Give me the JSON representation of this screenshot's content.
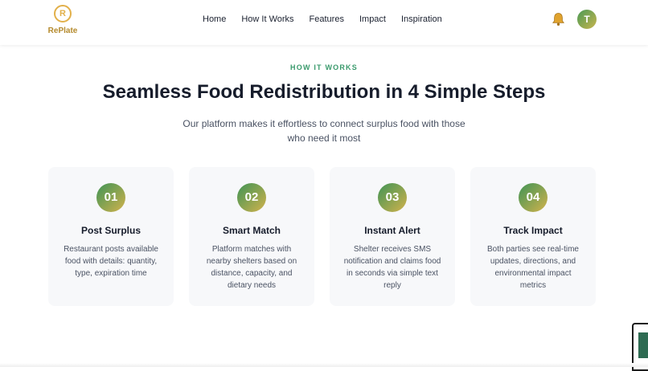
{
  "brand": {
    "name": "RePlate",
    "logo_letter": "R",
    "icon": "replate-logo-icon"
  },
  "nav": {
    "items": [
      {
        "label": "Home"
      },
      {
        "label": "How It Works"
      },
      {
        "label": "Features"
      },
      {
        "label": "Impact"
      },
      {
        "label": "Inspiration"
      }
    ]
  },
  "header": {
    "bell_icon": "bell-icon",
    "avatar_initial": "T"
  },
  "section": {
    "eyebrow": "HOW IT WORKS",
    "title": "Seamless Food Redistribution in 4 Simple Steps",
    "subtitle": "Our platform makes it effortless to connect surplus food with those who need it most"
  },
  "steps": [
    {
      "number": "01",
      "title": "Post Surplus",
      "description": "Restaurant posts available food with details: quantity, type, expiration time"
    },
    {
      "number": "02",
      "title": "Smart Match",
      "description": "Platform matches with nearby shelters based on distance, capacity, and dietary needs"
    },
    {
      "number": "03",
      "title": "Instant Alert",
      "description": "Shelter receives SMS notification and claims food in seconds via simple text reply"
    },
    {
      "number": "04",
      "title": "Track Impact",
      "description": "Both parties see real-time updates, directions, and environmental impact metrics"
    }
  ],
  "colors": {
    "accent_green": "#3a9a6c",
    "gradient_start": "#3f9456",
    "gradient_end": "#d2b24c",
    "brand_gold": "#b48a2c",
    "bell_gold": "#e0a32e"
  }
}
